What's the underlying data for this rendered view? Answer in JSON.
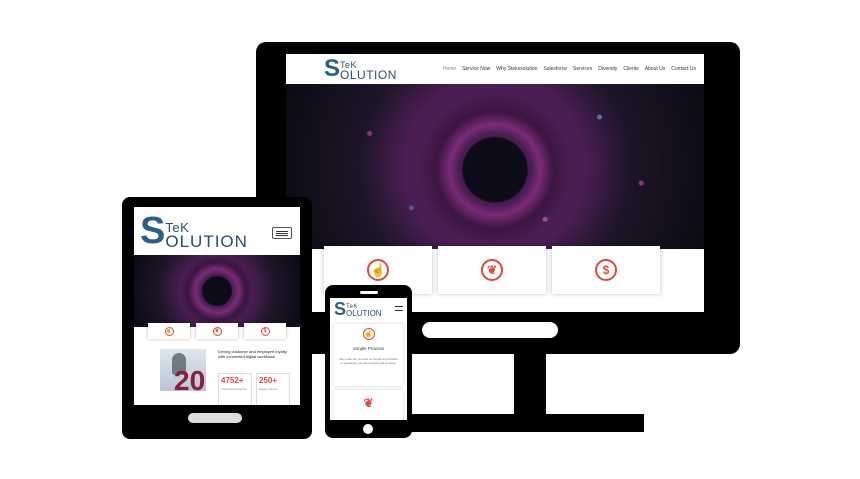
{
  "brand": {
    "s": "S",
    "tek": "TeK",
    "sol": "OLUTION"
  },
  "desktop": {
    "nav": [
      "Home",
      "Service Now",
      "Why Stekssolution",
      "Salesforce",
      "Services",
      "Diversity",
      "Clients",
      "About Us",
      "Contact Us"
    ],
    "cards": [
      {
        "icon": "hand-pointer-icon",
        "glyph": "☝"
      },
      {
        "icon": "leaf-icon",
        "glyph": "❦"
      },
      {
        "icon": "dollar-icon",
        "glyph": "$"
      }
    ]
  },
  "tablet": {
    "intro": "Driving customer and employee loyalty with connected digital workflows.",
    "badge": "20",
    "stats": [
      {
        "value": "4752+",
        "label": "Successful projects"
      },
      {
        "value": "250+",
        "label": "Happy clients"
      }
    ],
    "card_glyphs": [
      "☝",
      "❦",
      "$"
    ]
  },
  "phone": {
    "card_glyph": "☝",
    "title": "Simple Process",
    "description": "We make the process as simple as possible to guarantee you fast results and success.",
    "leaf_glyph": "❦"
  },
  "colors": {
    "accent": "#e04a3a",
    "brand": "#2b5f8a",
    "device": "#000000"
  }
}
